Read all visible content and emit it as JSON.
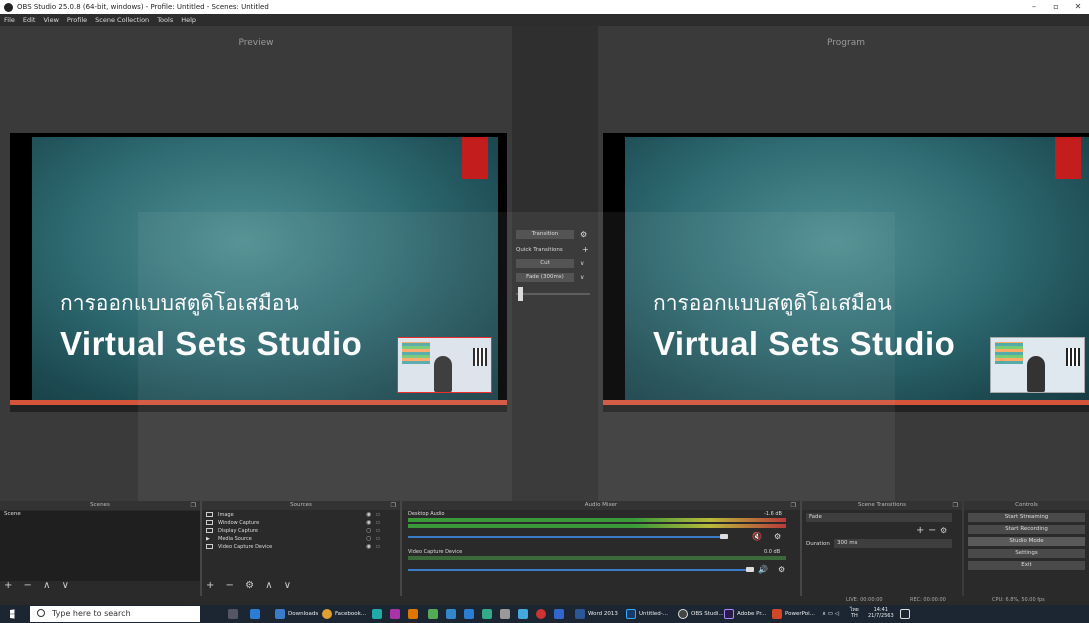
{
  "window": {
    "title": "OBS Studio 25.0.8 (64-bit, windows) - Profile: Untitled - Scenes: Untitled",
    "min_glyph": "–",
    "max_glyph": "▫",
    "close_glyph": "✕"
  },
  "menu": [
    "File",
    "Edit",
    "View",
    "Profile",
    "Scene Collection",
    "Tools",
    "Help"
  ],
  "preview": {
    "label": "Preview",
    "slide_line1": "การออกแบบสตูดิโอเสมือน",
    "slide_line2": "Virtual Sets Studio"
  },
  "program": {
    "label": "Program",
    "slide_line1": "การออกแบบสตูดิโอเสมือน",
    "slide_line2": "Virtual Sets Studio"
  },
  "transition_panel": {
    "transition_button": "Transition",
    "quick_transitions_label": "Quick Transitions",
    "add_glyph": "+",
    "gear_glyph": "⚙",
    "cut_label": "Cut",
    "fade_label": "Fade (300ms)",
    "chevron_glyph": "∨"
  },
  "scenes": {
    "header": "Scenes",
    "items": [
      "Scene"
    ],
    "toolbar": "+ − ∧ ∨"
  },
  "sources": {
    "header": "Sources",
    "items": [
      "Image",
      "Window Capture",
      "Display Capture",
      "Media Source",
      "Video Capture Device"
    ],
    "toolbar": "+ − ⚙ ∧ ∨"
  },
  "audio_mixer": {
    "header": "Audio Mixer",
    "channels": [
      {
        "name": "Desktop Audio",
        "db": "-1.6 dB",
        "volume": 0.92
      },
      {
        "name": "Video Capture Device",
        "db": "0.0 dB",
        "volume": 1.0
      }
    ]
  },
  "scene_transitions": {
    "header": "Scene Transitions",
    "selected": "Fade",
    "duration_label": "Duration",
    "duration_value": "300 ms"
  },
  "controls": {
    "header": "Controls",
    "buttons": [
      "Start Streaming",
      "Start Recording",
      "Studio Mode",
      "Settings",
      "Exit"
    ]
  },
  "status": {
    "live": "LIVE: 00:00:00",
    "rec": "REC: 00:00:00",
    "cpu": "CPU: 6.8%, 50.00 fps"
  },
  "taskbar": {
    "search_placeholder": "Type here to search",
    "items": [
      "Downloads",
      "Facebook...",
      "Word 2013",
      "Untitled-...",
      "OBS Studi...",
      "Adobe Pr...",
      "PowerPoi..."
    ],
    "time": "14:41",
    "date": "21/7/2563",
    "lang": "ไทย",
    "lang2": "TH"
  },
  "colors": {
    "panel_bg": "#2a2a2a",
    "accent_blue": "#3a7cc9",
    "slide_red": "#c41d1d",
    "mute_red": "#d33"
  }
}
